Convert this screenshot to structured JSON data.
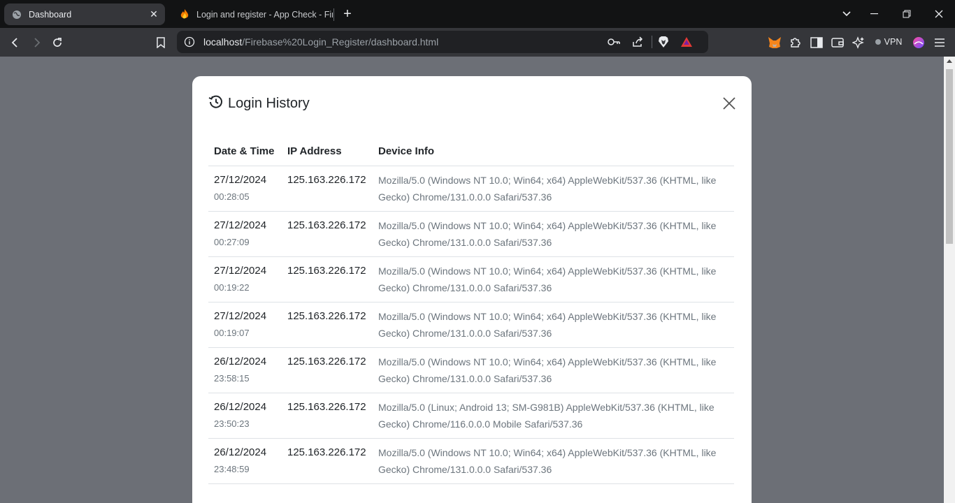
{
  "browser": {
    "tabs": [
      {
        "label": "Dashboard",
        "active": true,
        "icon": "globe-icon"
      },
      {
        "label": "Login and register - App Check - Fir",
        "active": false,
        "icon": "firebase-icon"
      }
    ],
    "url_host": "localhost",
    "url_path": "/Firebase%20Login_Register/dashboard.html",
    "vpn_label": "VPN"
  },
  "modal": {
    "title": "Login History",
    "columns": {
      "datetime": "Date & Time",
      "ip": "IP Address",
      "device": "Device Info"
    },
    "rows": [
      {
        "date": "27/12/2024",
        "time": "00:28:05",
        "ip": "125.163.226.172",
        "device": "Mozilla/5.0 (Windows NT 10.0; Win64; x64) AppleWebKit/537.36 (KHTML, like Gecko) Chrome/131.0.0.0 Safari/537.36"
      },
      {
        "date": "27/12/2024",
        "time": "00:27:09",
        "ip": "125.163.226.172",
        "device": "Mozilla/5.0 (Windows NT 10.0; Win64; x64) AppleWebKit/537.36 (KHTML, like Gecko) Chrome/131.0.0.0 Safari/537.36"
      },
      {
        "date": "27/12/2024",
        "time": "00:19:22",
        "ip": "125.163.226.172",
        "device": "Mozilla/5.0 (Windows NT 10.0; Win64; x64) AppleWebKit/537.36 (KHTML, like Gecko) Chrome/131.0.0.0 Safari/537.36"
      },
      {
        "date": "27/12/2024",
        "time": "00:19:07",
        "ip": "125.163.226.172",
        "device": "Mozilla/5.0 (Windows NT 10.0; Win64; x64) AppleWebKit/537.36 (KHTML, like Gecko) Chrome/131.0.0.0 Safari/537.36"
      },
      {
        "date": "26/12/2024",
        "time": "23:58:15",
        "ip": "125.163.226.172",
        "device": "Mozilla/5.0 (Windows NT 10.0; Win64; x64) AppleWebKit/537.36 (KHTML, like Gecko) Chrome/131.0.0.0 Safari/537.36"
      },
      {
        "date": "26/12/2024",
        "time": "23:50:23",
        "ip": "125.163.226.172",
        "device": "Mozilla/5.0 (Linux; Android 13; SM-G981B) AppleWebKit/537.36 (KHTML, like Gecko) Chrome/116.0.0.0 Mobile Safari/537.36"
      },
      {
        "date": "26/12/2024",
        "time": "23:48:59",
        "ip": "125.163.226.172",
        "device": "Mozilla/5.0 (Windows NT 10.0; Win64; x64) AppleWebKit/537.36 (KHTML, like Gecko) Chrome/131.0.0.0 Safari/537.36"
      }
    ]
  }
}
